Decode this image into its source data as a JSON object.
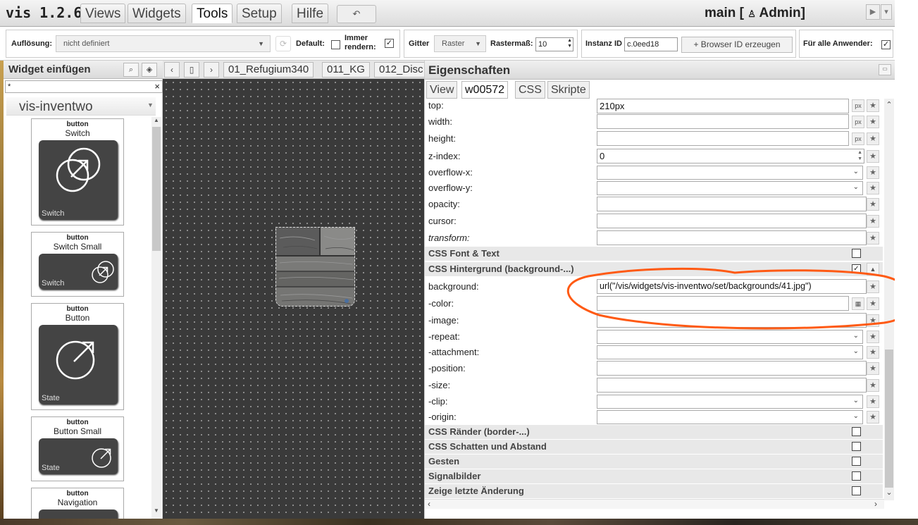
{
  "menubar": {
    "brand": "vis 1.2.6",
    "tabs": [
      "Views",
      "Widgets",
      "Tools",
      "Setup",
      "Hilfe"
    ],
    "undo_icon": "undo-icon",
    "view_title": "main [",
    "user_icon": "user-icon",
    "user": "Admin]"
  },
  "toolbar": {
    "resolution_label": "Auflösung:",
    "resolution_value": "nicht definiert",
    "default_label": "Default:",
    "always_render_label": "Immer rendern:",
    "always_render_checked": "✓",
    "grid_label": "Gitter",
    "grid_value": "Raster",
    "grid_size_label": "Rastermaß:",
    "grid_size_value": "10",
    "instance_label": "Instanz ID",
    "instance_value": "c.0eed18",
    "browser_id_button": "+ Browser ID erzeugen",
    "all_users_label": "Für alle Anwender:",
    "all_users_checked": "✓"
  },
  "left_panel": {
    "title": "Widget einfügen",
    "search_value": "*",
    "clear": "×",
    "set_name": "vis-inventwo",
    "widgets": [
      {
        "kind": "button",
        "name": "Switch",
        "caption": "Switch"
      },
      {
        "kind": "button",
        "name": "Switch Small",
        "caption": "Switch"
      },
      {
        "kind": "button",
        "name": "Button",
        "caption": "State"
      },
      {
        "kind": "button",
        "name": "Button Small",
        "caption": "State"
      },
      {
        "kind": "button",
        "name": "Navigation",
        "caption": ""
      }
    ]
  },
  "view_tabs": {
    "prev": "‹",
    "delete": "🗑",
    "next": "›",
    "tabs": [
      "01_Refugium340",
      "011_KG",
      "012_Disc"
    ]
  },
  "right_panel": {
    "title": "Eigenschaften",
    "tabs": [
      "View",
      "w00572",
      "CSS",
      "Skripte"
    ],
    "rows": {
      "top": {
        "label": "top:",
        "value": "210px",
        "unit": "px"
      },
      "width": {
        "label": "width:",
        "value": "",
        "unit": "px"
      },
      "height": {
        "label": "height:",
        "value": "",
        "unit": "px"
      },
      "zindex": {
        "label": "z-index:",
        "value": "0"
      },
      "overflowx": {
        "label": "overflow-x:"
      },
      "overflowy": {
        "label": "overflow-y:"
      },
      "opacity": {
        "label": "opacity:"
      },
      "cursor": {
        "label": "cursor:"
      },
      "transform": {
        "label": "transform:"
      },
      "font_group": {
        "label": "CSS Font & Text",
        "check": ""
      },
      "bg_group": {
        "label": "CSS Hintergrund (background-...)",
        "check": "✓"
      },
      "background": {
        "label": "background:",
        "value": "url(\"/vis/widgets/vis-inventwo/set/backgrounds/41.jpg\")"
      },
      "color": {
        "label": "-color:"
      },
      "image": {
        "label": "-image:"
      },
      "repeat": {
        "label": "-repeat:"
      },
      "attachment": {
        "label": "-attachment:"
      },
      "position": {
        "label": "-position:"
      },
      "size": {
        "label": "-size:"
      },
      "clip": {
        "label": "-clip:"
      },
      "origin": {
        "label": "-origin:"
      },
      "border_group": {
        "label": "CSS Ränder (border-...)",
        "check": ""
      },
      "shadow_group": {
        "label": "CSS Schatten und Abstand",
        "check": ""
      },
      "gestures_group": {
        "label": "Gesten",
        "check": ""
      },
      "signals_group": {
        "label": "Signalbilder",
        "check": ""
      },
      "lastchange_group": {
        "label": "Zeige letzte Änderung",
        "check": ""
      }
    }
  },
  "colors": {
    "annotation": "#ff5a14",
    "canvas": "#3a3a3a",
    "tile": "#444444"
  }
}
